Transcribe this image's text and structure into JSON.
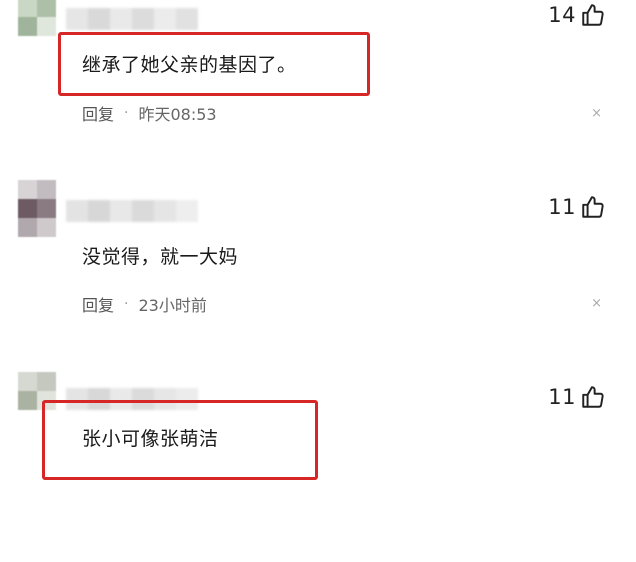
{
  "comments": [
    {
      "text": "继承了她父亲的基因了。",
      "likes": "14",
      "reply_label": "回复",
      "separator": "·",
      "time": "昨天08:53",
      "close": "×"
    },
    {
      "text": "没觉得，就一大妈",
      "likes": "11",
      "reply_label": "回复",
      "separator": "·",
      "time": "23小时前",
      "close": "×"
    },
    {
      "text": "张小可像张萌洁",
      "likes": "11"
    }
  ],
  "icons": {
    "like": "thumbs-up-icon",
    "close": "close-icon"
  },
  "colors": {
    "highlight": "#d62626",
    "text": "#1a1a1a",
    "meta": "#555555"
  }
}
